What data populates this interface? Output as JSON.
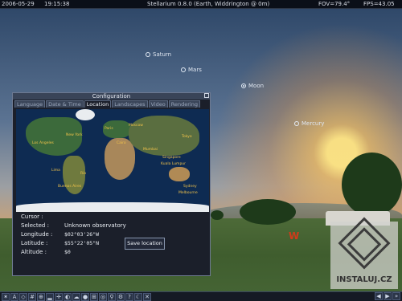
{
  "topbar": {
    "date": "2006-05-29",
    "time": "19:15:38",
    "title": "Stellarium 0.8.0 (Earth, Widdrington @ 0m)",
    "fov": "FOV=79.4°",
    "fps": "FPS=43.05"
  },
  "sky_objects": [
    "Saturn",
    "Mars",
    "Moon",
    "Mercury"
  ],
  "cardinal": "W",
  "config": {
    "title": "Configuration",
    "tabs": [
      "Language",
      "Date & Time",
      "Location",
      "Landscapes",
      "Video",
      "Rendering"
    ],
    "active_tab": "Location",
    "map_cities": [
      "New York",
      "Rio",
      "Buenos Aires",
      "Mumbai",
      "Singapore",
      "Sydney",
      "Melbourne",
      "Paris",
      "Moscow",
      "Tokyo",
      "Cairo",
      "Kuala Lumpur",
      "Los Angeles",
      "Lima"
    ],
    "cursor_label": "Cursor :",
    "selected_label": "Selected :",
    "selected_value": "Unknown observatory",
    "longitude_label": "Longitude :",
    "longitude_value": "$02°03'26\"W",
    "latitude_label": "Latitude :",
    "latitude_value": "$55°22'05\"N",
    "altitude_label": "Altitude :",
    "altitude_value": "$0",
    "save_button": "Save location"
  },
  "watermark": "INSTALUJ.CZ",
  "icons": [
    "constellation-icon",
    "grid-icon",
    "ground-icon",
    "atmosphere-icon",
    "search-icon",
    "config-icon",
    "quit-icon"
  ]
}
